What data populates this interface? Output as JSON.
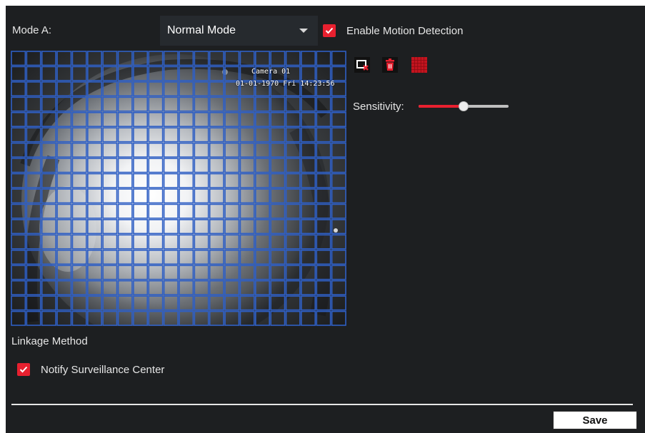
{
  "mode": {
    "label": "Mode A:",
    "selected": "Normal Mode"
  },
  "enable_motion": {
    "label": "Enable Motion Detection",
    "checked": true
  },
  "camera": {
    "osd_name": "Camera 01",
    "osd_time": "01-01-1970 Fri 14:23:56",
    "grid_columns": 22,
    "grid_rows": 18,
    "grid_color": "#2f5fc4"
  },
  "tools": {
    "clear": "clear-area-icon",
    "delete": "delete-icon",
    "draw_all": "draw-all-grid-icon"
  },
  "sensitivity": {
    "label": "Sensitivity:",
    "value_percent": 50
  },
  "linkage": {
    "title": "Linkage Method",
    "notify_label": "Notify Surveillance Center",
    "notify_checked": true
  },
  "save_label": "Save",
  "colors": {
    "accent": "#e8202f",
    "background": "#1d1f21"
  }
}
